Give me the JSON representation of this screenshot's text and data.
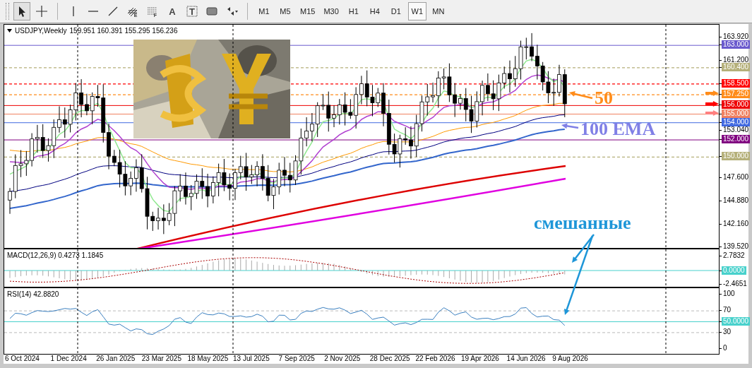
{
  "toolbar": {
    "tools": [
      {
        "kind": "cursor",
        "selected": true
      },
      {
        "kind": "crosshair",
        "selected": false
      },
      {
        "kind": "vline",
        "selected": false
      },
      {
        "kind": "hline",
        "selected": false
      },
      {
        "kind": "trendline",
        "selected": false
      },
      {
        "kind": "fibo-channel",
        "letter": "E",
        "selected": false
      },
      {
        "kind": "fibo-grid",
        "letter": "F",
        "selected": false
      },
      {
        "kind": "text",
        "letter": "A",
        "selected": false
      },
      {
        "kind": "label",
        "letter": "T",
        "selected": false
      },
      {
        "kind": "rectangle",
        "selected": false
      },
      {
        "kind": "arrows",
        "selected": false
      }
    ],
    "timeframes": [
      {
        "label": "M1",
        "selected": false
      },
      {
        "label": "M5",
        "selected": false
      },
      {
        "label": "M15",
        "selected": false
      },
      {
        "label": "M30",
        "selected": false
      },
      {
        "label": "H1",
        "selected": false
      },
      {
        "label": "H4",
        "selected": false
      },
      {
        "label": "D1",
        "selected": false
      },
      {
        "label": "W1",
        "selected": true
      },
      {
        "label": "MN",
        "selected": false
      }
    ]
  },
  "chart": {
    "title": "USDJPY,Weekly",
    "ohlc": "159.951 160.391 155.295 156.236",
    "price_labels": [
      {
        "text": "163.920",
        "kind": "plain"
      },
      {
        "text": "163.000",
        "kind": "level",
        "color": "#6a5acd",
        "dashed": false
      },
      {
        "text": "161.200",
        "kind": "plain"
      },
      {
        "text": "160.400",
        "kind": "level",
        "color": "#b5b07a",
        "dashed": true
      },
      {
        "text": "158.500",
        "kind": "level",
        "color": "#ff0000",
        "dashed": true
      },
      {
        "text": "157.250",
        "kind": "level",
        "color": "#ff8c1a",
        "dashed": true
      },
      {
        "text": "156.000",
        "kind": "level",
        "color": "#ee0000",
        "dashed": false
      },
      {
        "text": "155.000",
        "kind": "level",
        "color": "#f08060",
        "dashed": false
      },
      {
        "text": "154.000",
        "kind": "level",
        "color": "#4169e1",
        "dashed": false
      },
      {
        "text": "153.040",
        "kind": "plain"
      },
      {
        "text": "152.000",
        "kind": "level",
        "color": "#800080",
        "dashed": false
      },
      {
        "text": "150.000",
        "kind": "level",
        "color": "#b5b07a",
        "dashed": true
      },
      {
        "text": "147.600",
        "kind": "plain"
      },
      {
        "text": "144.880",
        "kind": "plain"
      },
      {
        "text": "142.160",
        "kind": "plain"
      },
      {
        "text": "139.520",
        "kind": "plain"
      }
    ],
    "level_arrows": [
      {
        "color": "#ff8c1a"
      },
      {
        "color": "#ff0000"
      },
      {
        "color": "#ff8080"
      }
    ],
    "annotations": [
      {
        "kind": "ma50",
        "text": "50",
        "color": "#ff8c1a"
      },
      {
        "kind": "ema100",
        "text": "100 EMA",
        "color": "#8080e6"
      },
      {
        "kind": "mixed",
        "text": "смешанные",
        "color": "#1e96d8"
      }
    ]
  },
  "macd": {
    "title": "MACD(12,26,9) 0.4273 1.1845",
    "labels": [
      {
        "text": "2.7832",
        "kind": "plain"
      },
      {
        "text": "0.0000",
        "kind": "highlight"
      },
      {
        "text": "-2.4651",
        "kind": "plain"
      }
    ]
  },
  "rsi": {
    "title": "RSI(14) 42.8820",
    "labels": [
      {
        "text": "100",
        "kind": "plain"
      },
      {
        "text": "70",
        "kind": "plain"
      },
      {
        "text": "50.0000",
        "kind": "highlight"
      },
      {
        "text": "30",
        "kind": "plain"
      },
      {
        "text": "0",
        "kind": "plain"
      }
    ]
  },
  "dates": [
    "6 Oct 2024",
    "1 Dec 2024",
    "26 Jan 2025",
    "23 Mar 2025",
    "18 May 2025",
    "13 Jul 2025",
    "7 Sep 2025",
    "2 Nov 2025",
    "28 Dec 2025",
    "22 Feb 2026",
    "19 Apr 2026",
    "14 Jun 2026",
    "9 Aug 2026"
  ]
}
